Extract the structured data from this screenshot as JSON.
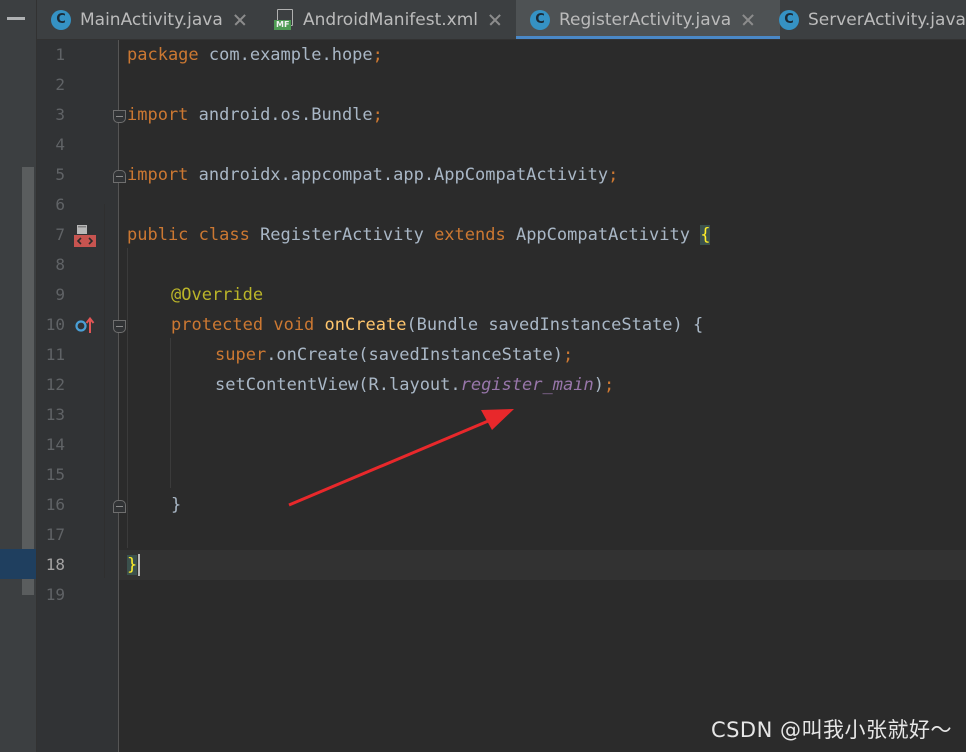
{
  "tabs": [
    {
      "name": "MainActivity.java",
      "icon": "java-class-icon",
      "icon_letter": "C",
      "active": false
    },
    {
      "name": "AndroidManifest.xml",
      "icon": "manifest-file-icon",
      "icon_badge": "MF",
      "active": false
    },
    {
      "name": "RegisterActivity.java",
      "icon": "java-class-icon",
      "icon_letter": "C",
      "active": true
    },
    {
      "name": "ServerActivity.java",
      "icon": "java-class-icon",
      "icon_letter": "C",
      "active": false
    }
  ],
  "editor": {
    "current_line": 18,
    "line_numbers": [
      "1",
      "2",
      "3",
      "4",
      "5",
      "6",
      "7",
      "8",
      "9",
      "10",
      "11",
      "12",
      "13",
      "14",
      "15",
      "16",
      "17",
      "18",
      "19"
    ],
    "code": {
      "l1_kw": "package",
      "l1_rest": " com.example.hope",
      "l1_semi": ";",
      "l3_kw": "import",
      "l3_rest": " android.os.Bundle",
      "l3_semi": ";",
      "l5_kw": "import",
      "l5_rest": " androidx.appcompat.app.AppCompatActivity",
      "l5_semi": ";",
      "l7_kw1": "public class",
      "l7_name": " RegisterActivity ",
      "l7_kw2": "extends",
      "l7_super": " AppCompatActivity ",
      "l7_brace": "{",
      "l9_ann": "@Override",
      "l10_kw": "protected void",
      "l10_method": "onCreate",
      "l10_rest": "(Bundle savedInstanceState) {",
      "l11_kw": "super",
      "l11_rest": ".onCreate(savedInstanceState)",
      "l11_semi": ";",
      "l12_pre": "setContentView(R.layout.",
      "l12_field": "register_main",
      "l12_post": ")",
      "l12_semi": ";",
      "l16_brace": "}",
      "l18_brace": "}"
    }
  },
  "colors": {
    "keyword": "#cc7832",
    "annotation": "#bbb529",
    "method": "#ffc66d",
    "field": "#9876aa",
    "plain": "#a9b7c6",
    "arrow": "#e8282b"
  },
  "gutter_icons": [
    "android-activity-icon",
    "override-method-icon"
  ],
  "watermark": "CSDN @叫我小张就好～"
}
